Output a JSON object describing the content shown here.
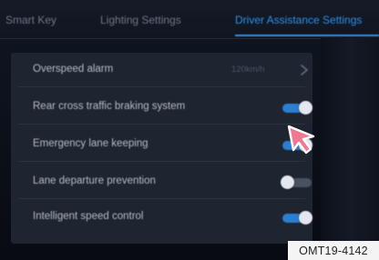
{
  "tabs": [
    {
      "label": "Smart Key",
      "active": false
    },
    {
      "label": "Lighting Settings",
      "active": false
    },
    {
      "label": "Driver Assistance Settings",
      "active": true
    }
  ],
  "settings": [
    {
      "label": "Overspeed alarm",
      "value": "120km/h",
      "control": "chevron"
    },
    {
      "label": "Rear cross traffic braking system",
      "control": "toggle",
      "on": true
    },
    {
      "label": "Emergency lane keeping",
      "control": "toggle",
      "on": true
    },
    {
      "label": "Lane departure prevention",
      "control": "toggle",
      "on": false
    },
    {
      "label": "Intelligent speed control",
      "control": "toggle",
      "on": true
    }
  ],
  "figure_code": "OMT19-4142",
  "colors": {
    "accent": "#2f8fe6",
    "toggle_on": "#2b7fd0",
    "toggle_off": "#4a5160",
    "pointer": "#f07890"
  },
  "icons": {
    "chevron": "chevron-right-icon",
    "pointer": "hand-pointer-icon"
  }
}
